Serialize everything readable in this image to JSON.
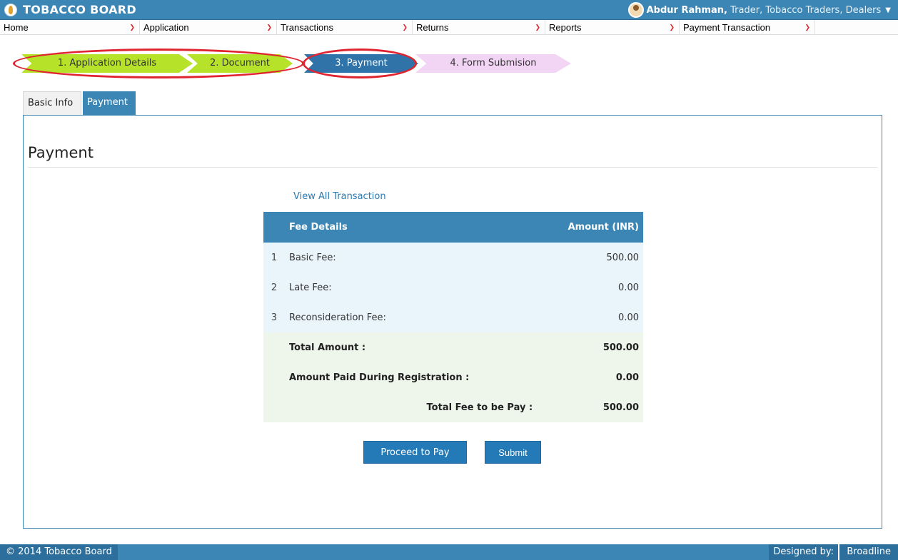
{
  "header": {
    "brand": "TOBACCO BOARD",
    "user_name": "Abdur Rahman,",
    "user_details": " Trader, Tobacco Traders, Dealers"
  },
  "menu": [
    {
      "label": "Home"
    },
    {
      "label": "Application"
    },
    {
      "label": "Transactions"
    },
    {
      "label": "Returns"
    },
    {
      "label": "Reports"
    },
    {
      "label": "Payment Transaction"
    }
  ],
  "steps": [
    {
      "label": "1. Application Details",
      "state": "done"
    },
    {
      "label": "2. Document",
      "state": "done"
    },
    {
      "label": "3. Payment",
      "state": "active"
    },
    {
      "label": "4. Form Submision",
      "state": "pending"
    }
  ],
  "tabs": [
    {
      "label": "Basic Info"
    },
    {
      "label": "Payment"
    }
  ],
  "payment": {
    "title": "Payment",
    "view_link": "View All Transaction",
    "table": {
      "header_fee": "Fee Details",
      "header_amount": "Amount (INR)",
      "rows": [
        {
          "num": "1",
          "label": "Basic Fee:",
          "amount": "500.00"
        },
        {
          "num": "2",
          "label": "Late Fee:",
          "amount": "0.00"
        },
        {
          "num": "3",
          "label": "Reconsideration Fee:",
          "amount": "0.00"
        }
      ],
      "total_label": "Total Amount :",
      "total_amount": "500.00",
      "paid_label": "Amount Paid During Registration :",
      "paid_amount": "0.00",
      "payable_label": "Total Fee to be Pay :",
      "payable_amount": "500.00"
    },
    "proceed_label": "Proceed to Pay",
    "submit_label": "Submit"
  },
  "footer": {
    "copyright": "© 2014 Tobacco Board",
    "designed_by": "Designed by:",
    "designer": "Broadline"
  },
  "colors": {
    "primary": "#3b86b5",
    "step_done": "#b6e32a",
    "step_active": "#2f73a8",
    "step_pending": "#f2d4f5",
    "highlight_ring": "#e0242f"
  }
}
